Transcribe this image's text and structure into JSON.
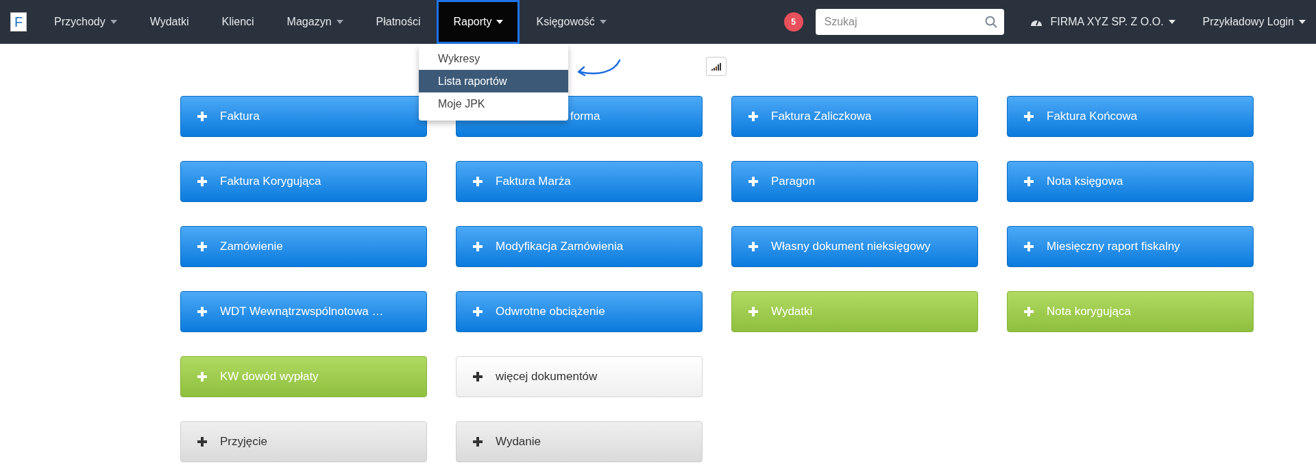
{
  "navbar": {
    "logo": "F",
    "items": [
      {
        "label": "Przychody",
        "dropdown": true,
        "selected": false
      },
      {
        "label": "Wydatki",
        "dropdown": false,
        "selected": false
      },
      {
        "label": "Klienci",
        "dropdown": false,
        "selected": false
      },
      {
        "label": "Magazyn",
        "dropdown": true,
        "selected": false
      },
      {
        "label": "Płatności",
        "dropdown": false,
        "selected": false
      },
      {
        "label": "Raporty",
        "dropdown": true,
        "selected": true
      },
      {
        "label": "Księgowość",
        "dropdown": true,
        "selected": false
      }
    ],
    "notification_count": "5",
    "search": {
      "placeholder": "Szukaj"
    },
    "company": "FIRMA XYZ SP. Z O.O.",
    "user": "Przykładowy Login"
  },
  "dropdown_menu": [
    {
      "label": "Wykresy",
      "selected": false
    },
    {
      "label": "Lista raportów",
      "selected": true
    },
    {
      "label": "Moje JPK",
      "selected": false
    }
  ],
  "document_rows": [
    [
      {
        "label": "Faktura",
        "kind": "blue",
        "covered": false
      },
      {
        "label": "forma",
        "kind": "blue",
        "covered": true
      },
      {
        "label": "Faktura Zaliczkowa",
        "kind": "blue",
        "covered": false
      },
      {
        "label": "Faktura Końcowa",
        "kind": "blue",
        "covered": false
      }
    ],
    [
      {
        "label": "Faktura Korygująca",
        "kind": "blue",
        "covered": false
      },
      {
        "label": "Faktura Marża",
        "kind": "blue",
        "covered": false
      },
      {
        "label": "Paragon",
        "kind": "blue",
        "covered": false
      },
      {
        "label": "Nota księgowa",
        "kind": "blue",
        "covered": false
      }
    ],
    [
      {
        "label": "Zamówienie",
        "kind": "blue",
        "covered": false
      },
      {
        "label": "Modyfikacja Zamówienia",
        "kind": "blue",
        "covered": false
      },
      {
        "label": "Własny dokument nieksięgowy",
        "kind": "blue",
        "covered": false
      },
      {
        "label": "Miesięczny raport fiskalny",
        "kind": "blue",
        "covered": false
      }
    ],
    [
      {
        "label": "WDT Wewnątrzwspólnotowa …",
        "kind": "blue",
        "covered": false
      },
      {
        "label": "Odwrotne obciążenie",
        "kind": "blue",
        "covered": false
      },
      {
        "label": "Wydatki",
        "kind": "green",
        "covered": false
      },
      {
        "label": "Nota korygująca",
        "kind": "green",
        "covered": false
      }
    ],
    [
      {
        "label": "KW dowód wypłaty",
        "kind": "green",
        "covered": false
      },
      {
        "label": "więcej dokumentów",
        "kind": "white",
        "covered": false
      }
    ],
    [
      {
        "label": "Przyjęcie",
        "kind": "grey",
        "covered": false
      },
      {
        "label": "Wydanie",
        "kind": "grey",
        "covered": false
      }
    ]
  ]
}
